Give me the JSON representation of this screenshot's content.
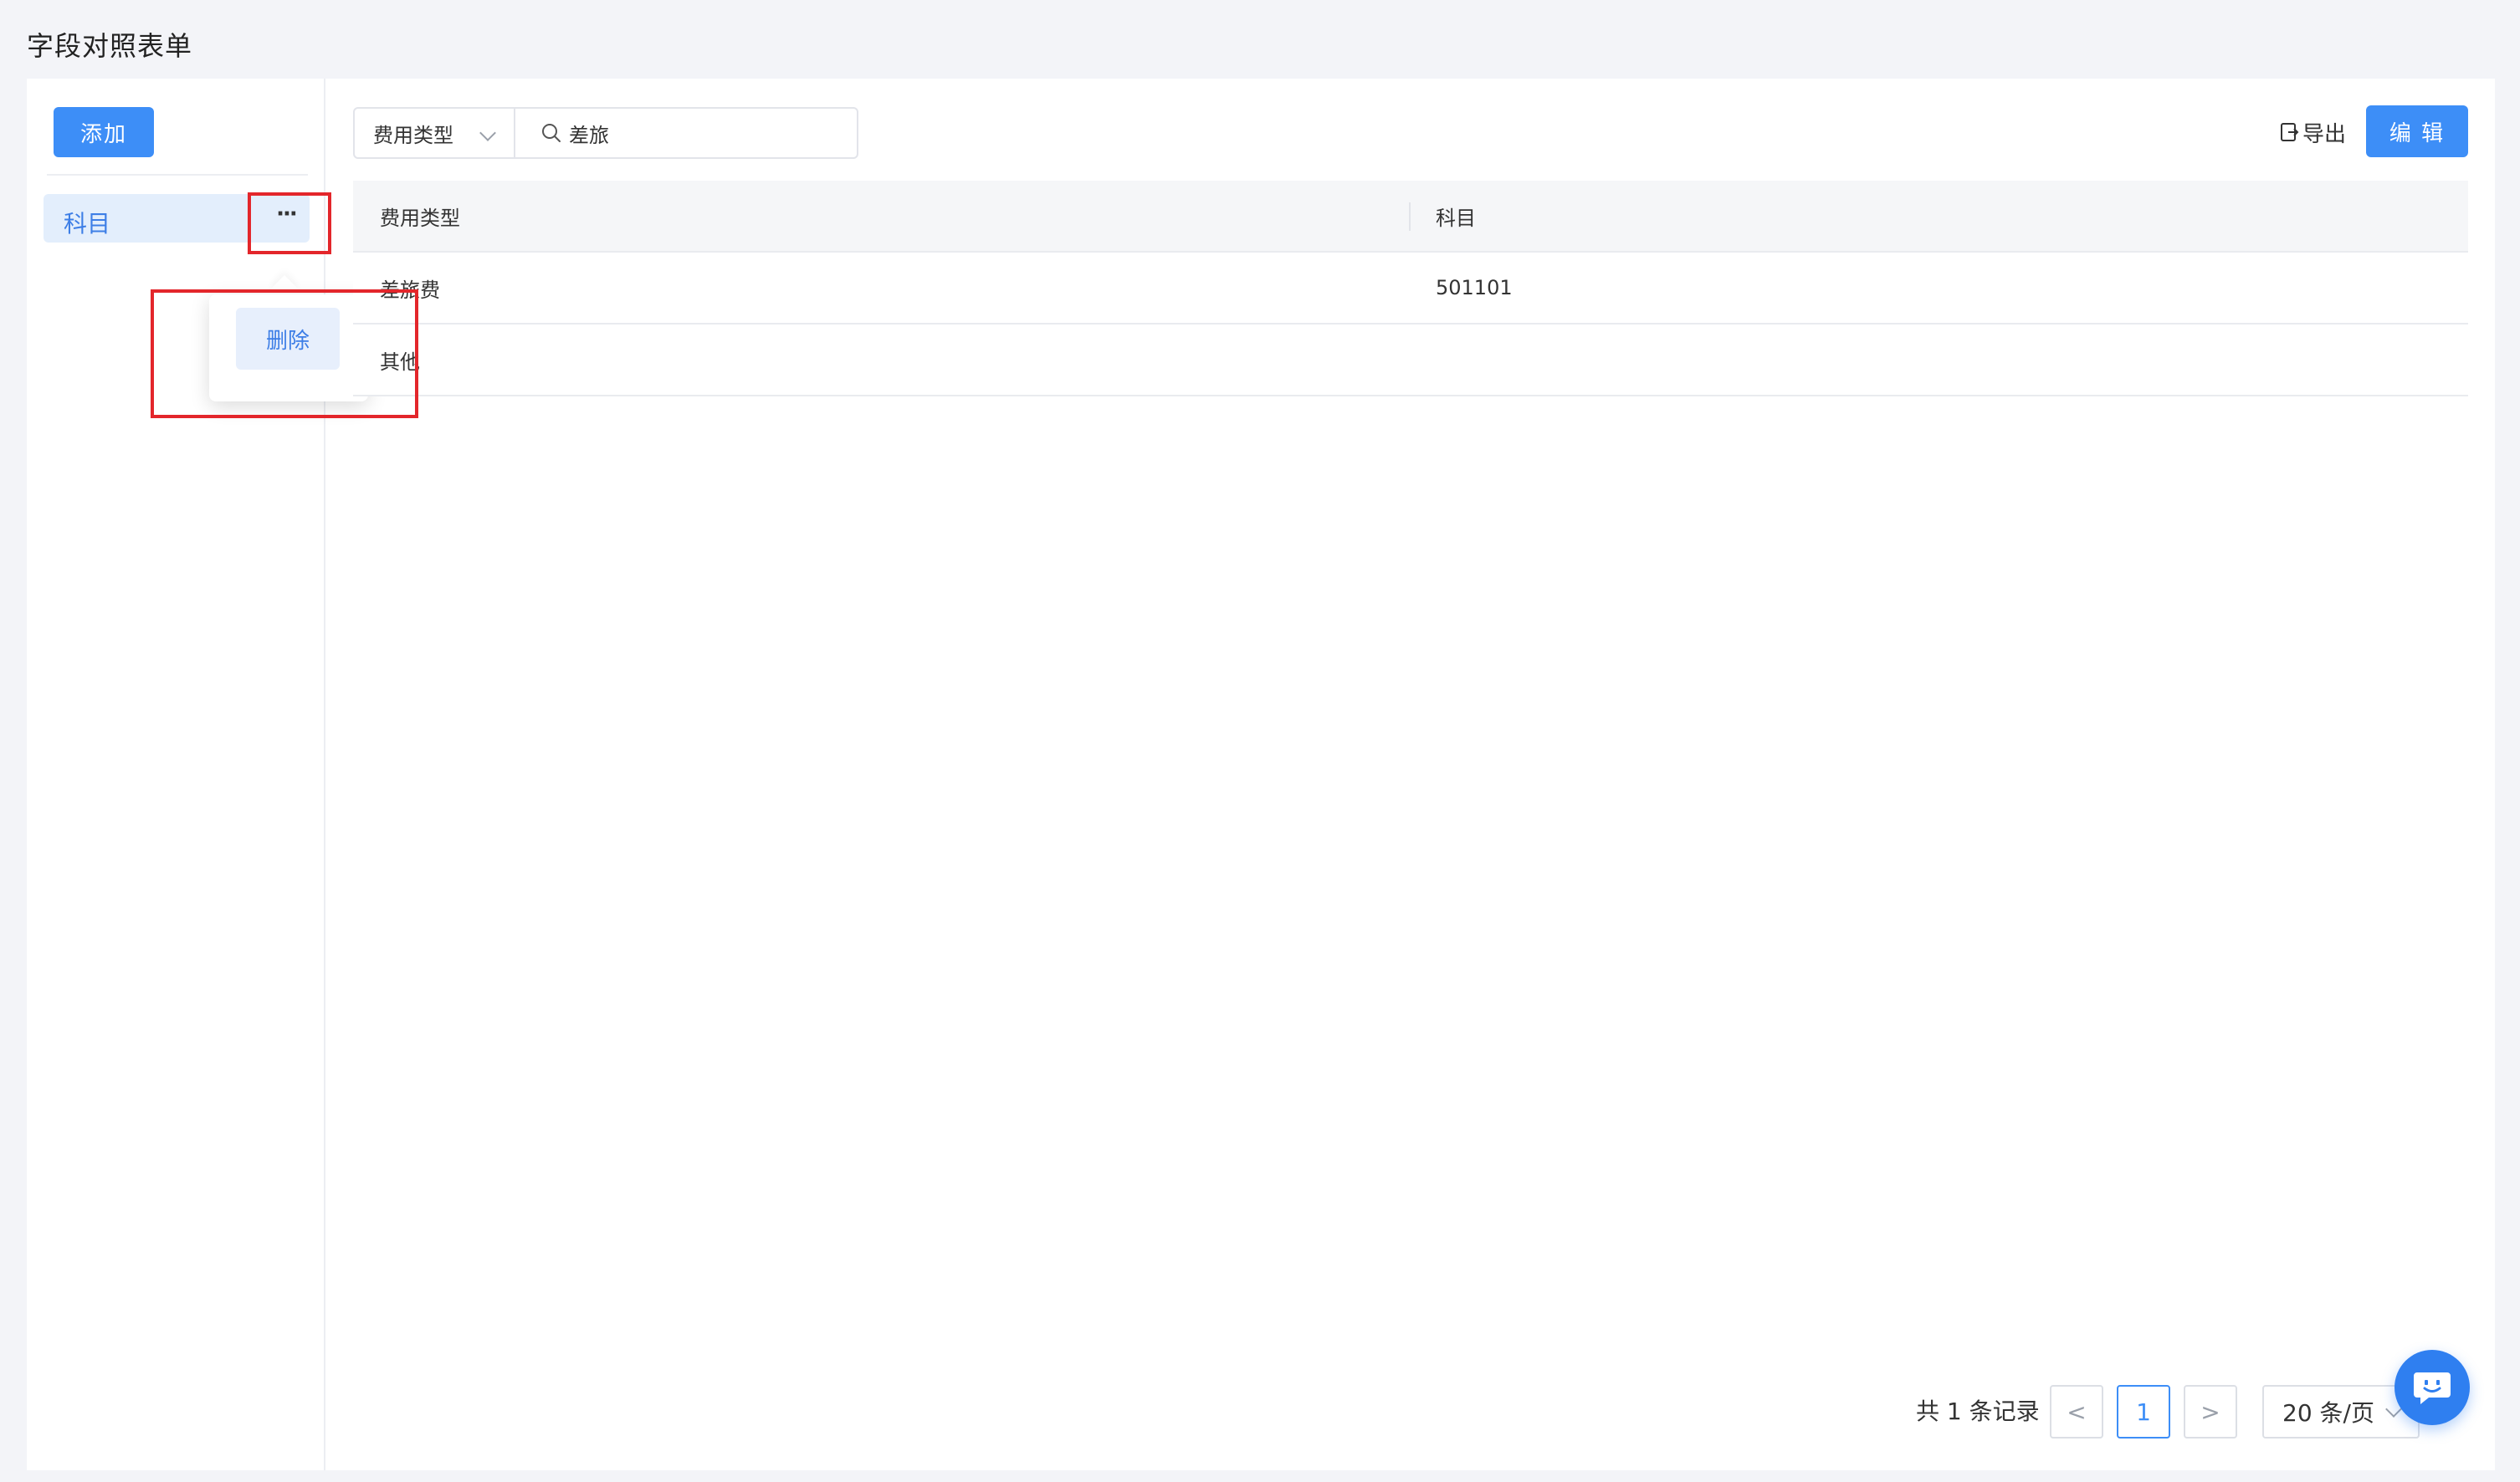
{
  "page": {
    "title": "字段对照表单"
  },
  "left_panel": {
    "add_label": "添加",
    "tree_items": [
      {
        "label": "科目"
      }
    ],
    "more_label": "···",
    "popover": {
      "delete_label": "删除"
    }
  },
  "toolbar": {
    "filter_field": "费用类型",
    "search_value": "差旅",
    "export_label": "导出",
    "edit_label": "编 辑"
  },
  "table": {
    "columns": [
      "费用类型",
      "科目"
    ],
    "rows": [
      {
        "fee_type": "差旅费",
        "subject": "501101"
      },
      {
        "fee_type": "其他",
        "subject": ""
      }
    ]
  },
  "pagination": {
    "total_text": "共 1 条记录",
    "prev": "<",
    "current_page": "1",
    "next": ">",
    "page_size": "20 条/页"
  },
  "colors": {
    "primary": "#3d8ef7",
    "highlight": "#e3262b",
    "selected_bg": "#e3eefc"
  },
  "icons": [
    "search-icon",
    "export-icon",
    "chevron-down-icon",
    "more-icon",
    "chat-icon"
  ]
}
